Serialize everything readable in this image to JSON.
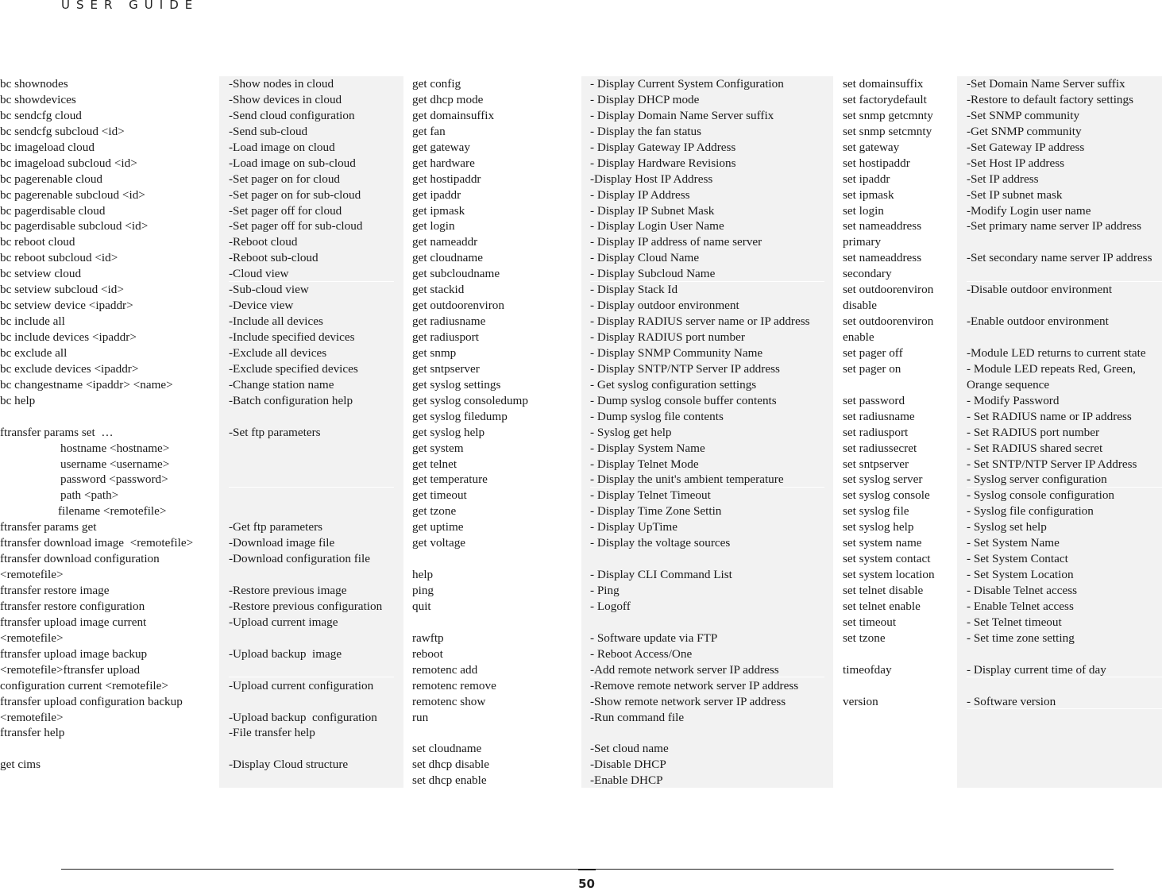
{
  "header": {
    "title": "USER GUIDE"
  },
  "columns": {
    "commands_1": [
      "bc shownodes",
      "bc showdevices",
      "bc sendcfg cloud",
      "bc sendcfg subcloud <id>",
      "bc imageload cloud",
      "bc imageload subcloud <id>",
      "bc pagerenable cloud",
      "bc pagerenable subcloud <id>",
      "bc pagerdisable cloud",
      "bc pagerdisable subcloud <id>",
      "bc reboot cloud",
      "bc reboot subcloud <id>",
      "bc setview cloud",
      "bc setview subcloud <id>",
      "bc setview device <ipaddr>",
      "bc include all",
      "bc include devices <ipaddr>",
      "bc exclude all",
      "bc exclude devices <ipaddr>",
      "bc changestname <ipaddr> <name>",
      "bc help",
      "",
      "ftransfer params set  …",
      "hostname <hostname>",
      "username <username>",
      "password <password>",
      "path <path>",
      "filename <remotefile>",
      "ftransfer params get",
      "ftransfer download image  <remotefile>",
      "ftransfer download configuration",
      "<remotefile>",
      "ftransfer restore image",
      "ftransfer restore configuration",
      "ftransfer upload image current",
      "<remotefile>",
      "ftransfer upload image backup",
      "<remotefile>ftransfer upload",
      "configuration current <remotefile>",
      "ftransfer upload configuration backup",
      "<remotefile>",
      "ftransfer help",
      "",
      "get cims"
    ],
    "descriptions_1": [
      "-Show nodes in cloud",
      "-Show devices in cloud",
      "-Send cloud configuration",
      "-Send sub-cloud",
      "-Load image on cloud",
      "-Load image on sub-cloud",
      "-Set pager on for cloud",
      "-Set pager on for sub-cloud",
      "-Set pager off for cloud",
      "-Set pager off for sub-cloud",
      "-Reboot cloud",
      "-Reboot sub-cloud",
      "-Cloud view",
      "-Sub-cloud view",
      "-Device view",
      "-Include all devices",
      "-Include specified devices",
      "-Exclude all devices",
      "-Exclude specified devices",
      "-Change station name",
      "-Batch configuration help",
      "",
      "-Set ftp parameters",
      "",
      "",
      "",
      "",
      "",
      "-Get ftp parameters",
      "-Download image file",
      "-Download configuration file",
      "",
      "-Restore previous image",
      "-Restore previous configuration",
      "-Upload current image",
      "",
      "-Upload backup  image",
      "",
      "-Upload current configuration",
      "",
      "-Upload backup  configuration",
      "-File transfer help",
      "",
      "-Display Cloud structure"
    ],
    "commands_2": [
      "get config",
      "get dhcp mode",
      "get domainsuffix",
      "get fan",
      "get gateway",
      "get hardware",
      "get hostipaddr",
      "get ipaddr",
      "get ipmask",
      "get login",
      "get nameaddr",
      "get cloudname",
      "get subcloudname",
      "get stackid",
      "get outdoorenviron",
      "get radiusname",
      "get radiusport",
      "get snmp",
      "get sntpserver",
      "get syslog settings",
      "get syslog consoledump",
      "get syslog filedump",
      "get syslog help",
      "get system",
      "get telnet",
      "get temperature",
      "get timeout",
      "get tzone",
      "get uptime",
      "get voltage",
      "",
      "help",
      "ping",
      "quit",
      "",
      "rawftp",
      "reboot",
      "remotenc add",
      "remotenc remove",
      "remotenc show",
      "run",
      "",
      "set cloudname",
      "set dhcp disable",
      "set dhcp enable"
    ],
    "descriptions_2": [
      "- Display Current System Configuration",
      "- Display DHCP mode",
      "- Display Domain Name Server suffix",
      "- Display the fan status",
      "- Display Gateway IP Address",
      "- Display Hardware Revisions",
      "-Display Host IP Address",
      "- Display IP Address",
      "- Display IP Subnet Mask",
      "- Display Login User Name",
      "- Display IP address of name server",
      "- Display Cloud Name",
      "- Display Subcloud Name",
      "- Display Stack Id",
      "- Display outdoor environment",
      "- Display RADIUS server name or IP address",
      "- Display RADIUS port number",
      "- Display SNMP Community Name",
      "- Display SNTP/NTP Server IP address",
      "- Get syslog configuration settings",
      "- Dump syslog console buffer contents",
      "- Dump syslog file contents",
      "- Syslog get help",
      "- Display System Name",
      "- Display Telnet Mode",
      "- Display the unit's ambient temperature",
      "- Display Telnet Timeout",
      "- Display Time Zone Settin",
      "- Display UpTime",
      "- Display the voltage sources",
      "",
      "- Display CLI Command List",
      "- Ping",
      "- Logoff",
      "",
      "- Software update via FTP",
      "- Reboot Access/One",
      "-Add remote network server IP address",
      "-Remove remote network server IP address",
      "-Show remote network server IP address",
      "-Run command file",
      "",
      "-Set cloud name",
      "-Disable DHCP",
      "-Enable DHCP"
    ],
    "commands_3": [
      "set domainsuffix",
      "set factorydefault",
      "set snmp getcmnty",
      "set snmp setcmnty",
      "set gateway",
      "set hostipaddr",
      "set ipaddr",
      "set ipmask",
      "set login",
      "set nameaddress",
      "primary",
      "set nameaddress",
      "secondary",
      "set outdoorenviron",
      "disable",
      "set outdoorenviron",
      "enable",
      "set pager off",
      "set pager on",
      "",
      "set password",
      "set radiusname",
      "set radiusport",
      "set radiussecret",
      "set sntpserver",
      "set syslog server",
      "set syslog console",
      "set syslog file",
      "set syslog help",
      "set system name",
      "set system contact",
      "set system location",
      "set telnet disable",
      "set telnet enable",
      "set timeout",
      "set tzone",
      "",
      "timeofday",
      "",
      "version"
    ],
    "descriptions_3": [
      "-Set Domain Name Server suffix",
      "-Restore to default factory settings",
      "-Set SNMP community",
      "-Get SNMP community",
      "-Set Gateway IP address",
      "-Set Host IP address",
      "-Set IP address",
      "-Set IP subnet mask",
      "-Modify Login user name",
      "-Set primary name server IP address",
      "",
      "-Set secondary name server IP address",
      "",
      "-Disable outdoor environment",
      "",
      "-Enable outdoor environment",
      "",
      "-Module LED returns to current state",
      "- Module LED repeats Red, Green,",
      "Orange sequence",
      "- Modify Password",
      "- Set RADIUS name or IP address",
      "- Set RADIUS port number",
      "- Set RADIUS shared secret",
      "- Set SNTP/NTP Server IP Address",
      "- Syslog server configuration",
      "- Syslog console configuration",
      "- Syslog file configuration",
      "- Syslog set help",
      "- Set System Name",
      "- Set System Contact",
      "- Set System Location",
      "- Disable Telnet access",
      "- Enable Telnet access",
      "- Set Telnet timeout",
      "- Set time zone setting",
      "",
      "- Display current time of day",
      "",
      "- Software version"
    ]
  },
  "footer": {
    "page_number": "50"
  }
}
